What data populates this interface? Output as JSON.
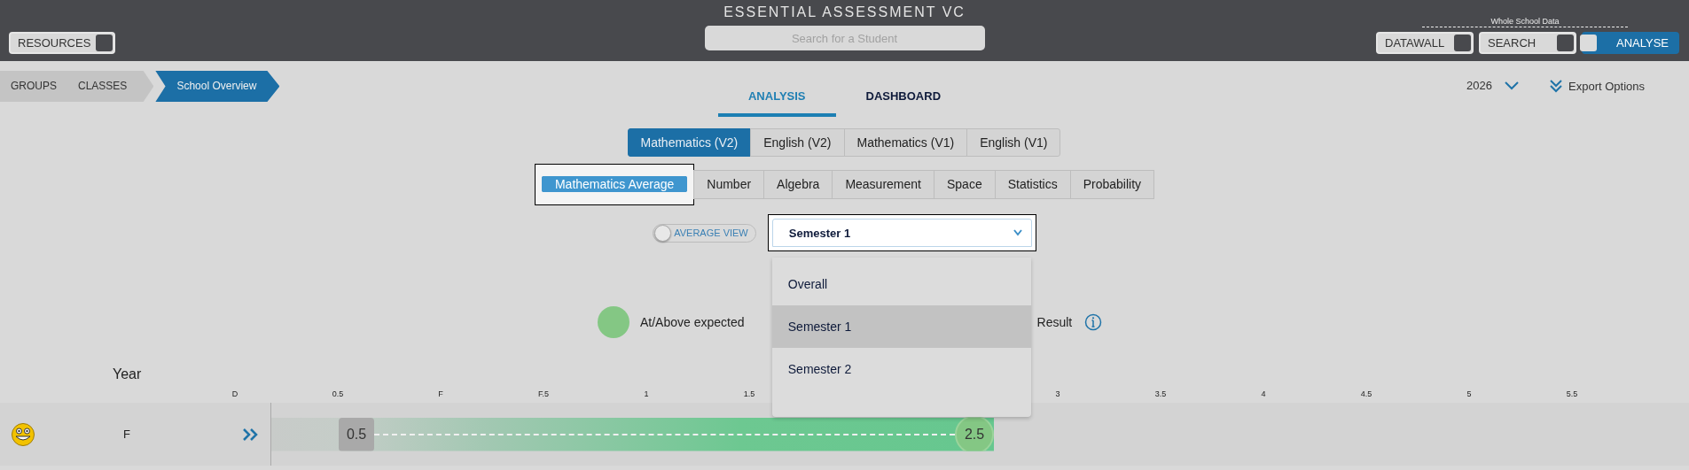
{
  "header": {
    "title": "ESSENTIAL ASSESSMENT VC",
    "search": {
      "placeholder": "Search for a Student"
    },
    "resources_button": "RESOURCES",
    "group_label": "Whole School Data",
    "mode_buttons": [
      {
        "label": "DATAWALL",
        "selected": false
      },
      {
        "label": "SEARCH",
        "selected": false
      },
      {
        "label": "ANALYSE",
        "selected": true
      }
    ]
  },
  "breadcrumb": [
    {
      "label": "GROUPS",
      "selected": false
    },
    {
      "label": "CLASSES",
      "selected": false
    },
    {
      "label": "School Overview",
      "selected": true
    }
  ],
  "view_tabs": [
    {
      "label": "ANALYSIS",
      "selected": true
    },
    {
      "label": "DASHBOARD",
      "selected": false
    }
  ],
  "year": "2026",
  "export": "Export Options",
  "subject_tabs": [
    {
      "label": "Mathematics (V2)",
      "selected": true
    },
    {
      "label": "English (V2)",
      "selected": false
    },
    {
      "label": "Mathematics (V1)",
      "selected": false
    },
    {
      "label": "English (V1)",
      "selected": false
    }
  ],
  "strand_tabs": [
    {
      "label": "Mathematics Average",
      "selected": true
    },
    {
      "label": "Number",
      "selected": false
    },
    {
      "label": "Algebra",
      "selected": false
    },
    {
      "label": "Measurement",
      "selected": false
    },
    {
      "label": "Space",
      "selected": false
    },
    {
      "label": "Statistics",
      "selected": false
    },
    {
      "label": "Probability",
      "selected": false
    }
  ],
  "average_view": {
    "label": "AVERAGE VIEW",
    "on": false
  },
  "period_select": {
    "value": "Semester 1",
    "expanded": true,
    "options": [
      {
        "label": "Overall",
        "selected": false
      },
      {
        "label": "Semester 1",
        "selected": true
      },
      {
        "label": "Semester 2",
        "selected": false
      }
    ]
  },
  "legend": [
    {
      "label": "At/Above expected",
      "color": "#84c784"
    },
    {
      "label": "Result"
    }
  ],
  "year_header": "Year",
  "ticks": [
    "D",
    "0.5",
    "F",
    "F.5",
    "1",
    "1.5",
    "3",
    "3.5",
    "4",
    "4.5",
    "5",
    "5.5"
  ],
  "rows": [
    {
      "year": "F",
      "start": "0.5",
      "end": "2.5"
    }
  ]
}
